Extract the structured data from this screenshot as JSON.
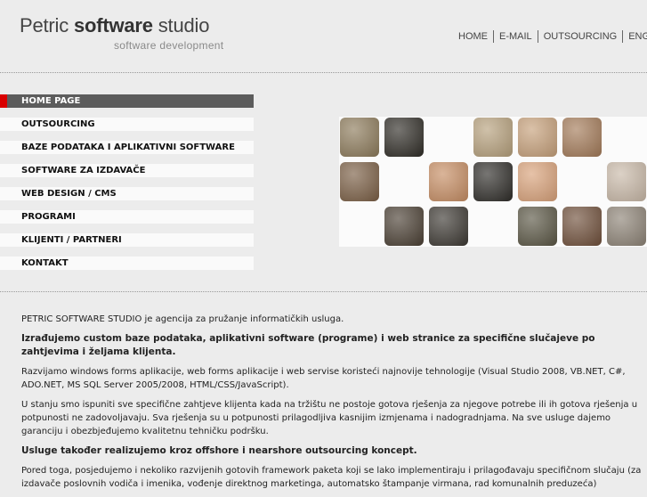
{
  "brand": {
    "name_regular": "Petric ",
    "name_bold": "software",
    "name_tail": " studio",
    "tagline": "software development"
  },
  "topnav": [
    "HOME",
    "E-MAIL",
    "OUTSOURCING",
    "ENGLISH"
  ],
  "menu": [
    "HOME PAGE",
    "OUTSOURCING",
    "BAZE PODATAKA I APLIKATIVNI SOFTWARE",
    "SOFTWARE ZA IZDAVAČE",
    "WEB DESIGN / CMS",
    "PROGRAMI",
    "KLIJENTI / PARTNERI",
    "KONTAKT"
  ],
  "active_menu_index": 0,
  "colors": {
    "active_bg": "#5c5c5c",
    "accent": "#d90000",
    "background": "#ececec"
  },
  "photo_tiles": [
    {
      "color": "#8c7a5a"
    },
    {
      "color": "#2f2c26"
    },
    {
      "color": "#b6a07c"
    },
    {
      "color": "#c6a07a"
    },
    {
      "color": "#a37a58"
    },
    {
      "color": "#7a5e44"
    },
    {
      "color": "#c68d63"
    },
    {
      "color": "#2e2c28"
    },
    {
      "color": "#d9a27a"
    },
    {
      "color": "#c9b9a8"
    },
    {
      "color": "#4a3f33"
    },
    {
      "color": "#3c3832"
    },
    {
      "color": "#5a5644"
    },
    {
      "color": "#6f4f3a"
    },
    {
      "color": "#8d8376"
    }
  ],
  "content": {
    "p1": "PETRIC SOFTWARE STUDIO je agencija za pružanje informatičkih usluga.",
    "p2": "Izrađujemo custom baze podataka, aplikativni software (programe) i web stranice za specifične slučajeve po zahtjevima i željama klijenta.",
    "p3": "Razvijamo windows forms aplikacije, web forms aplikacije i web servise koristeći najnovije tehnologije (Visual Studio 2008, VB.NET, C#, ADO.NET, MS SQL Server 2005/2008, HTML/CSS/JavaScript).",
    "p4": "U stanju smo ispuniti sve specifične zahtjeve klijenta kada na tržištu ne postoje gotova rješenja za njegove potrebe ili ih gotova rješenja u potpunosti ne zadovoljavaju. Sva rješenja su u potpunosti prilagodljiva kasnijim izmjenama i nadogradnjama. Na sve usluge dajemo garanciju i obezbjeđujemo kvalitetnu tehničku podršku.",
    "p5": "Usluge također realizujemo kroz offshore i nearshore outsourcing koncept.",
    "p6": "Pored toga, posjedujemo i nekoliko razvijenih gotovih framework paketa koji se lako implementiraju i prilagođavaju specifičnom slučaju (za izdavače poslovnih vodiča i imenika, vođenje direktnog marketinga, automatsko štampanje virmana, rad komunalnih preduzeća)"
  }
}
